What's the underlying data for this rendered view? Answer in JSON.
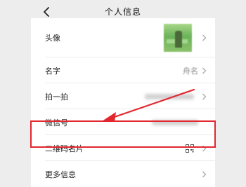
{
  "header": {
    "title": "个人信息"
  },
  "rows": {
    "avatar": {
      "label": "头像"
    },
    "name": {
      "label": "名字",
      "value": "舟名"
    },
    "pat": {
      "label": "拍一拍"
    },
    "wechat_id": {
      "label": "微信号"
    },
    "qr_card": {
      "label": "二维码名片"
    },
    "more_info": {
      "label": "更多信息"
    }
  },
  "colors": {
    "background": "#ededed",
    "highlight": "#e2272f",
    "arrow": "#e2272f"
  },
  "icons": {
    "back": "chevron-left-icon",
    "row_arrow": "chevron-right-icon",
    "qr": "qr-code-icon"
  }
}
